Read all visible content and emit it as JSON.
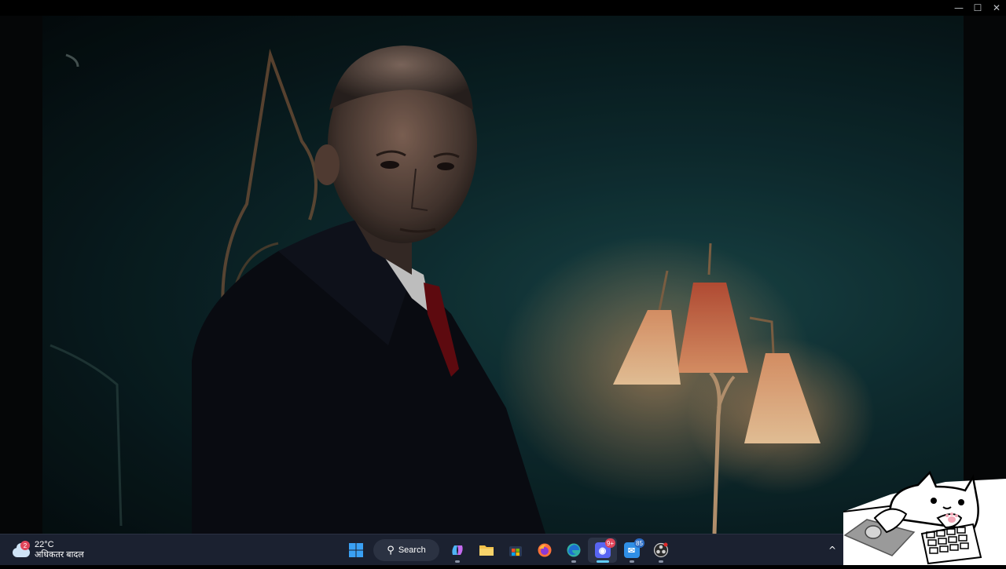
{
  "window": {
    "controls": [
      "minimize",
      "maximize",
      "close"
    ],
    "minimize_glyph": "—",
    "maximize_glyph": "☐",
    "close_glyph": "✕"
  },
  "video": {
    "scene": "film frame"
  },
  "taskbar": {
    "weather": {
      "badge": "2",
      "temperature": "22°C",
      "condition": "अधिकतर बादल",
      "icon": "cloud-icon"
    },
    "search": {
      "label": "Search",
      "icon": "search-icon"
    },
    "apps": [
      {
        "name": "start",
        "icon": "windows-start-icon",
        "color": "#3aa0f3"
      },
      {
        "name": "copilot",
        "icon": "copilot-icon",
        "color": "#7b6cf6"
      },
      {
        "name": "file-explorer",
        "icon": "folder-icon",
        "color": "#f2c14b"
      },
      {
        "name": "microsoft-store",
        "icon": "store-icon",
        "color": "#4aa3f0"
      },
      {
        "name": "firefox",
        "icon": "firefox-icon",
        "color": "#ff7139"
      },
      {
        "name": "edge",
        "icon": "edge-icon",
        "color": "#2fb1a6"
      },
      {
        "name": "discord",
        "icon": "discord-icon",
        "color": "#5865f2",
        "badge": "9+"
      },
      {
        "name": "messenger",
        "icon": "chat-icon",
        "color": "#2f8fe6",
        "badge": "85"
      },
      {
        "name": "obs",
        "icon": "obs-icon",
        "color": "#3a3a3a"
      }
    ],
    "tray_chevron": "^"
  },
  "overlay": {
    "name": "bongo-cat-overlay",
    "icon": "bongo-cat-icon"
  }
}
